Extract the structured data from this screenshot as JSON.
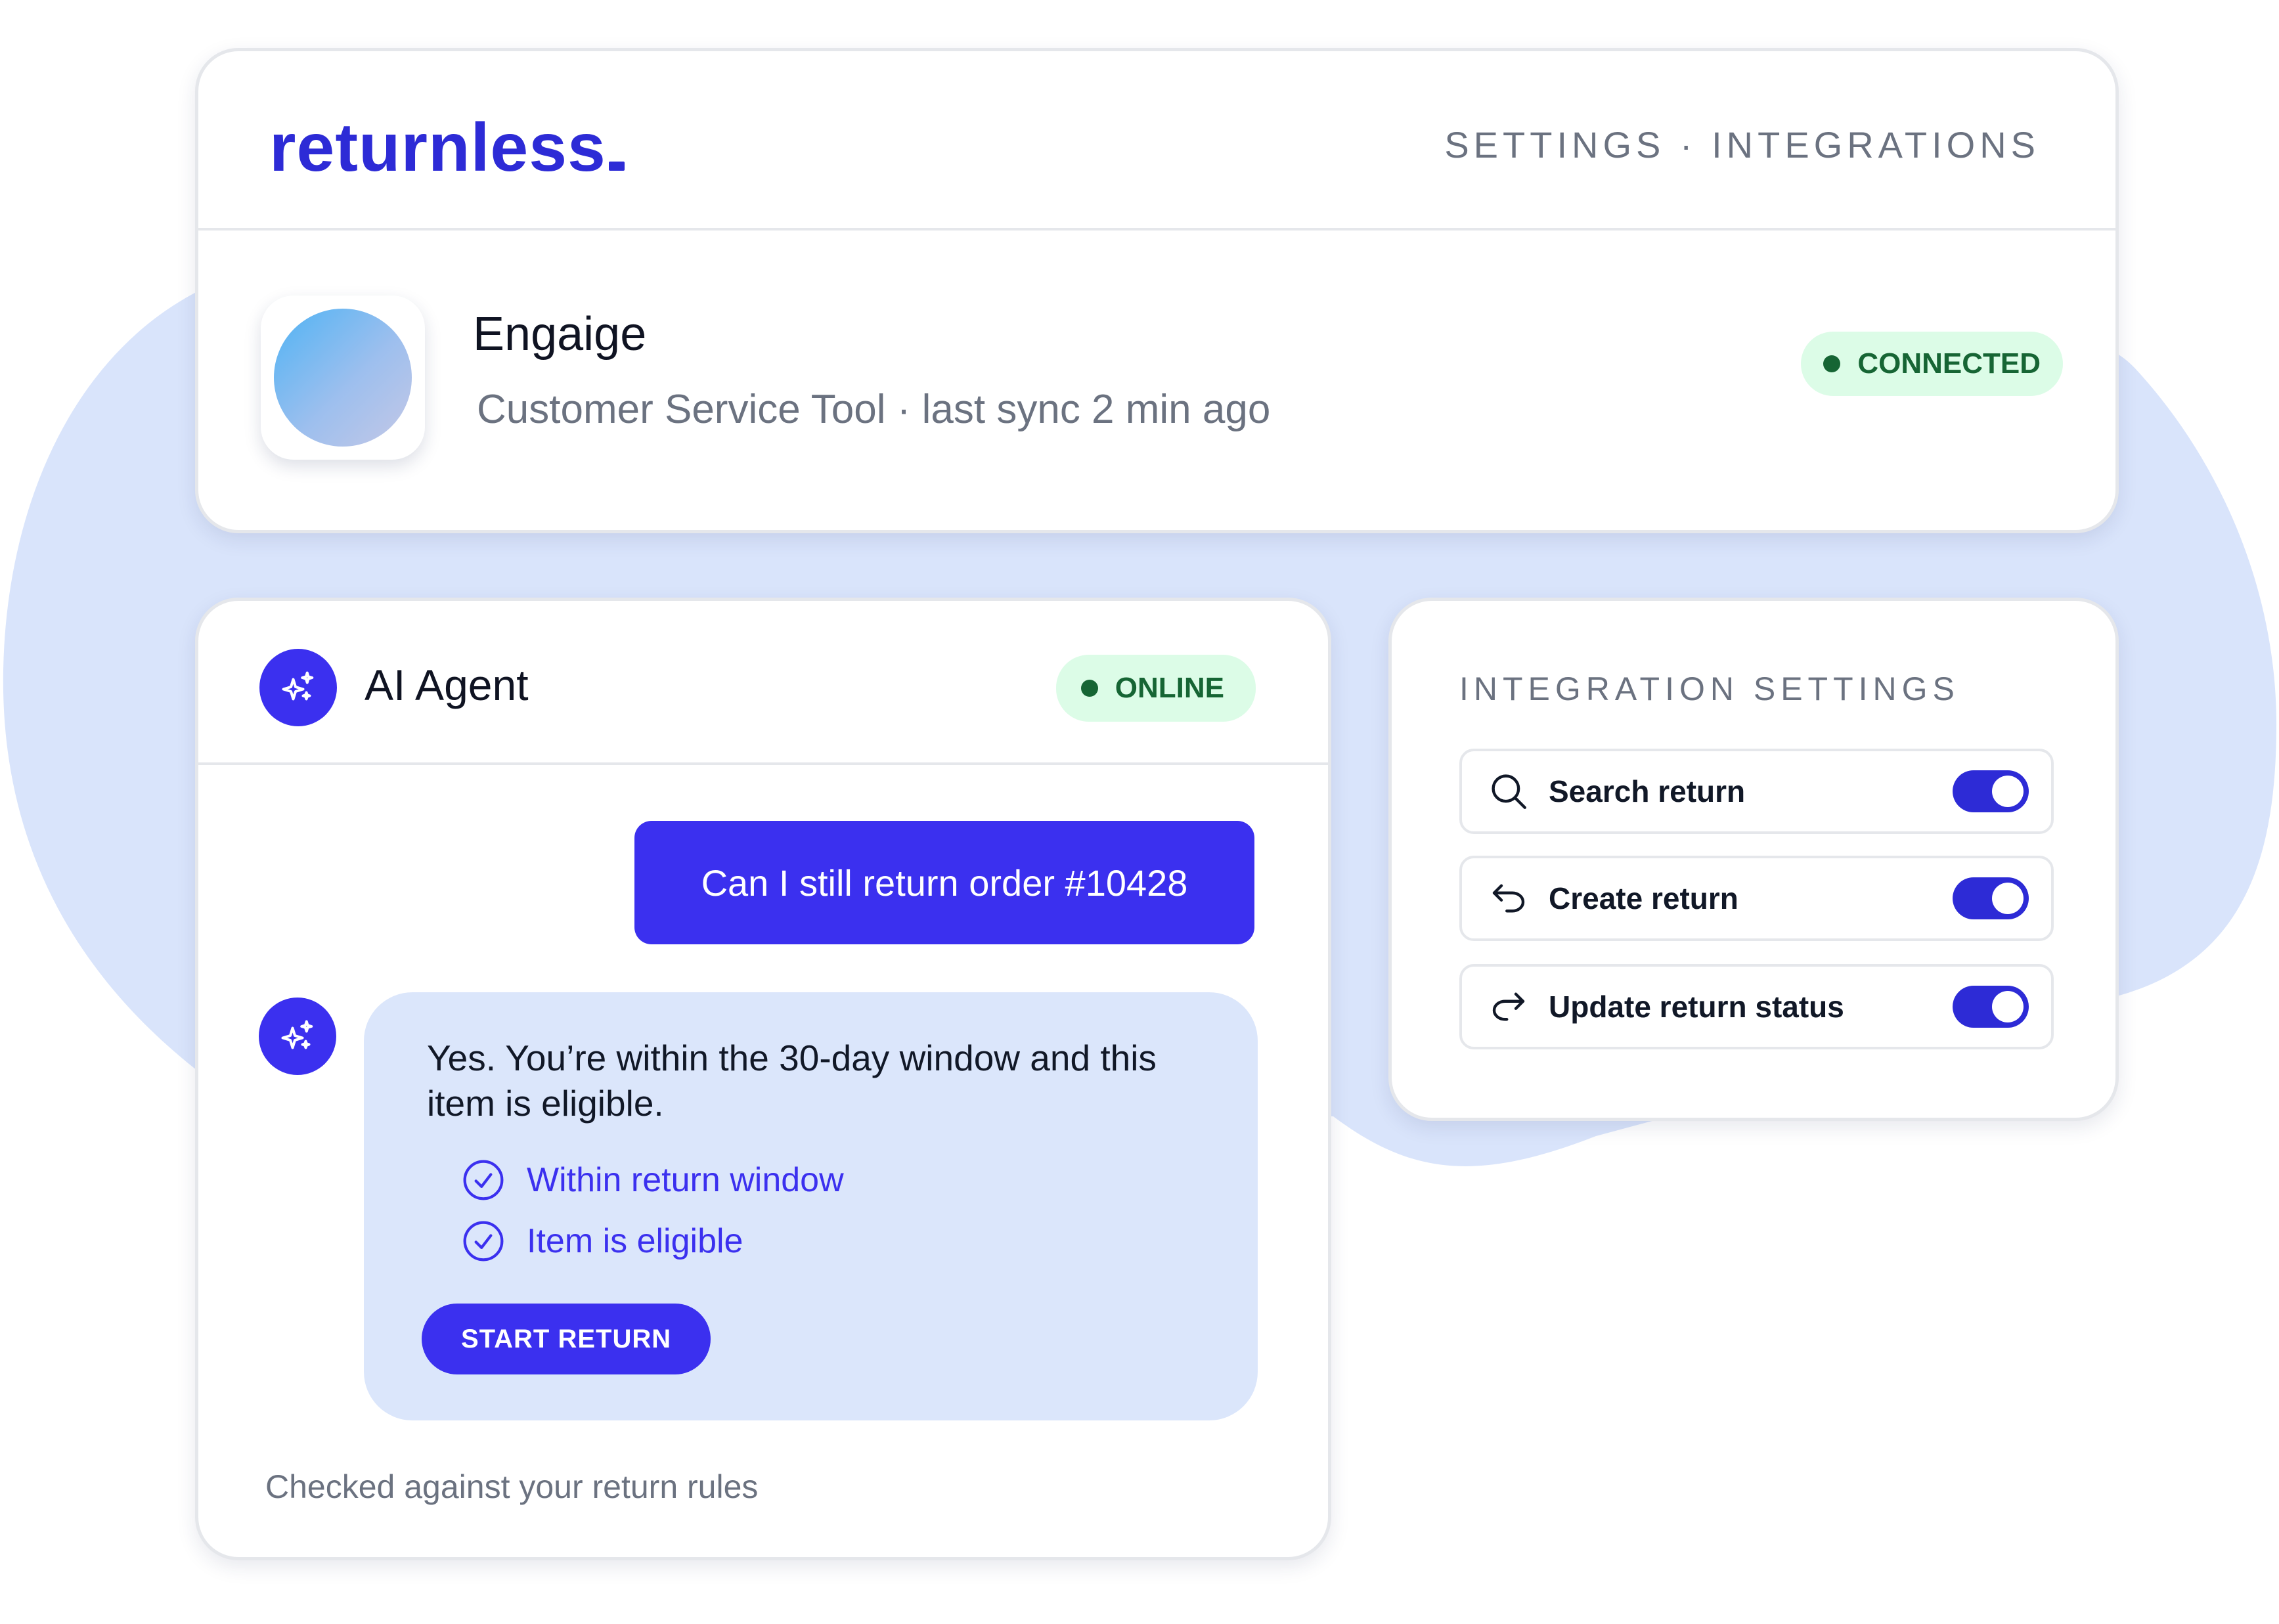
{
  "brand": {
    "logo_text": "returnless",
    "accent_color": "#2d2bd6"
  },
  "header": {
    "breadcrumb": "SETTINGS · INTEGRATIONS"
  },
  "integration": {
    "name": "Engaige",
    "meta": "Customer Service Tool · last sync 2 min ago",
    "status": "CONNECTED",
    "status_color": "#166534"
  },
  "chat": {
    "title": "AI Agent",
    "status": "ONLINE",
    "avatar_icon": "sparkles-icon",
    "user_message": "Can I still return order #10428",
    "bot_reply": "Yes. You’re within the 30-day window and this item is eligible.",
    "checks": [
      "Within return window",
      "Item is eligible"
    ],
    "check_icon": "check-circle-icon",
    "action_button": "START RETURN",
    "footer": "Checked against your return rules"
  },
  "settings": {
    "title": "INTEGRATION SETTINGS",
    "items": [
      {
        "label": "Search return",
        "icon": "search-icon",
        "enabled": true
      },
      {
        "label": "Create return",
        "icon": "undo-arrow-icon",
        "enabled": true
      },
      {
        "label": "Update return status",
        "icon": "redo-arrow-icon",
        "enabled": true
      }
    ]
  }
}
